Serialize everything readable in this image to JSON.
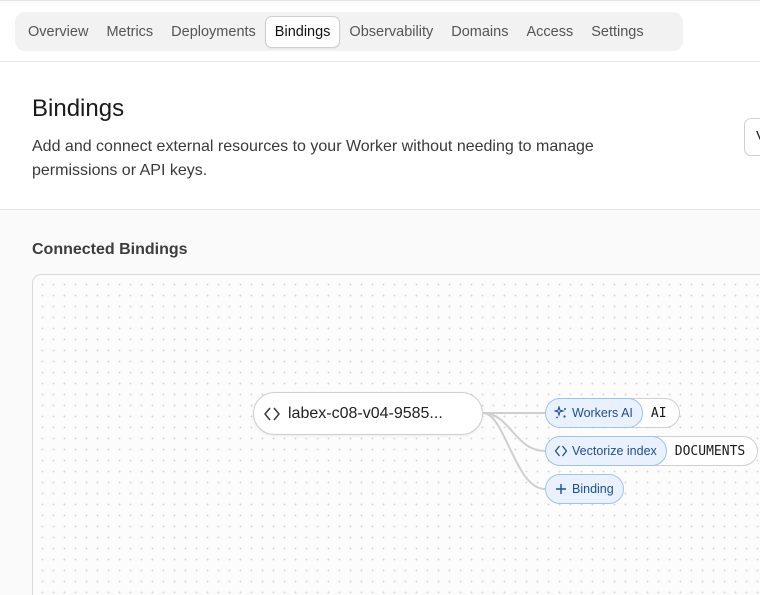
{
  "tabs": [
    {
      "label": "Overview"
    },
    {
      "label": "Metrics"
    },
    {
      "label": "Deployments"
    },
    {
      "label": "Bindings",
      "active": true
    },
    {
      "label": "Observability"
    },
    {
      "label": "Domains"
    },
    {
      "label": "Access"
    },
    {
      "label": "Settings"
    }
  ],
  "header": {
    "title": "Bindings",
    "description": "Add and connect external resources to your Worker without needing to manage permissions or API keys.",
    "right_button_label": "V"
  },
  "connected": {
    "title": "Connected Bindings",
    "worker": {
      "name": "labex-c08-v04-9585...",
      "icon": "code-diamond-icon"
    },
    "bindings": [
      {
        "type_label": "Workers AI",
        "variable": "AI",
        "icon": "sparkle-icon"
      },
      {
        "type_label": "Vectorize index",
        "variable": "DOCUMENTS",
        "icon": "code-diamond-icon"
      }
    ],
    "add_binding_label": "Binding",
    "add_icon": "plus-icon"
  },
  "colors": {
    "accent": "#1d4f95",
    "chip_bg": "#e8f1fd",
    "chip_border": "#9ec3f3"
  }
}
